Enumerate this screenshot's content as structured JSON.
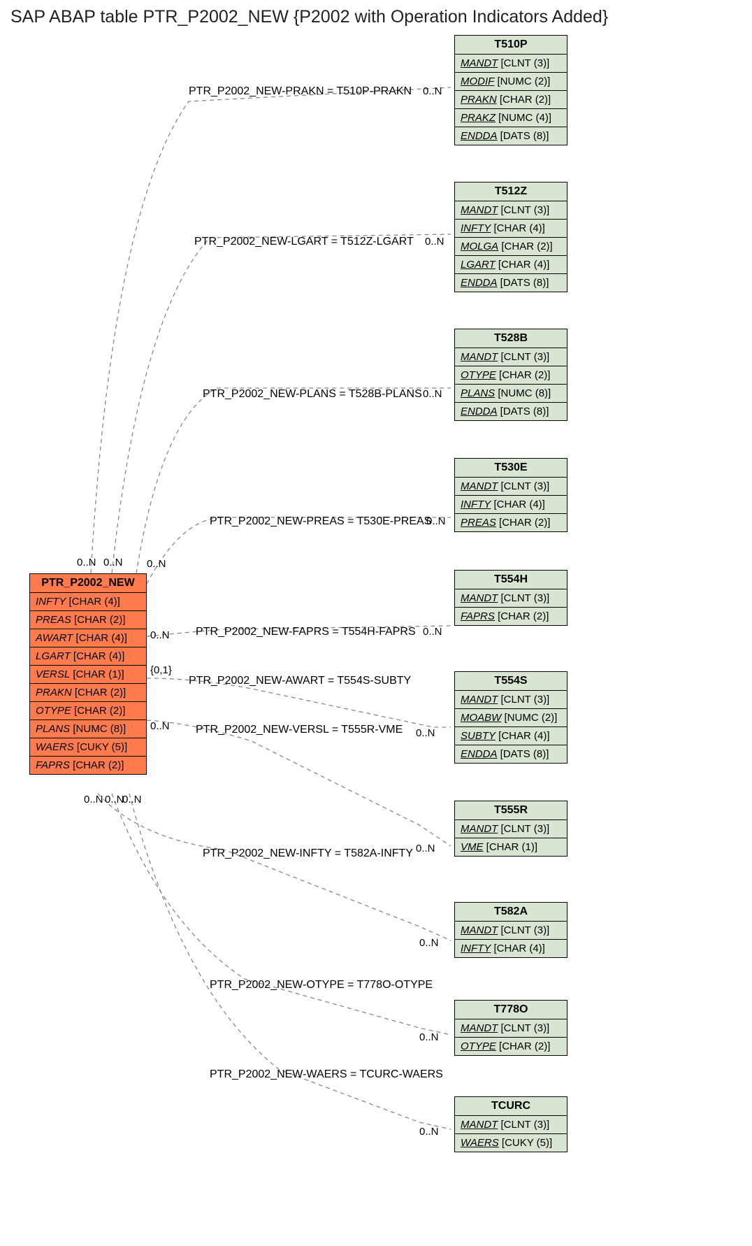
{
  "title": "SAP ABAP table PTR_P2002_NEW {P2002 with Operation Indicators Added}",
  "main": {
    "name": "PTR_P2002_NEW",
    "fields": [
      {
        "f": "INFTY",
        "t": "[CHAR (4)]"
      },
      {
        "f": "PREAS",
        "t": "[CHAR (2)]"
      },
      {
        "f": "AWART",
        "t": "[CHAR (4)]"
      },
      {
        "f": "LGART",
        "t": "[CHAR (4)]"
      },
      {
        "f": "VERSL",
        "t": "[CHAR (1)]"
      },
      {
        "f": "PRAKN",
        "t": "[CHAR (2)]"
      },
      {
        "f": "OTYPE",
        "t": "[CHAR (2)]"
      },
      {
        "f": "PLANS",
        "t": "[NUMC (8)]"
      },
      {
        "f": "WAERS",
        "t": "[CUKY (5)]"
      },
      {
        "f": "FAPRS",
        "t": "[CHAR (2)]"
      }
    ]
  },
  "targets": [
    {
      "name": "T510P",
      "fields": [
        {
          "f": "MANDT",
          "t": "[CLNT (3)]",
          "u": true
        },
        {
          "f": "MODIF",
          "t": "[NUMC (2)]",
          "u": true
        },
        {
          "f": "PRAKN",
          "t": "[CHAR (2)]",
          "u": true
        },
        {
          "f": "PRAKZ",
          "t": "[NUMC (4)]",
          "u": true
        },
        {
          "f": "ENDDA",
          "t": "[DATS (8)]",
          "u": true
        }
      ]
    },
    {
      "name": "T512Z",
      "fields": [
        {
          "f": "MANDT",
          "t": "[CLNT (3)]",
          "u": true
        },
        {
          "f": "INFTY",
          "t": "[CHAR (4)]",
          "u": true
        },
        {
          "f": "MOLGA",
          "t": "[CHAR (2)]",
          "u": true
        },
        {
          "f": "LGART",
          "t": "[CHAR (4)]",
          "u": true
        },
        {
          "f": "ENDDA",
          "t": "[DATS (8)]",
          "u": true
        }
      ]
    },
    {
      "name": "T528B",
      "fields": [
        {
          "f": "MANDT",
          "t": "[CLNT (3)]",
          "u": true
        },
        {
          "f": "OTYPE",
          "t": "[CHAR (2)]",
          "u": true
        },
        {
          "f": "PLANS",
          "t": "[NUMC (8)]",
          "u": true
        },
        {
          "f": "ENDDA",
          "t": "[DATS (8)]",
          "u": true
        }
      ]
    },
    {
      "name": "T530E",
      "fields": [
        {
          "f": "MANDT",
          "t": "[CLNT (3)]",
          "u": true
        },
        {
          "f": "INFTY",
          "t": "[CHAR (4)]",
          "u": true
        },
        {
          "f": "PREAS",
          "t": "[CHAR (2)]",
          "u": true
        }
      ]
    },
    {
      "name": "T554H",
      "fields": [
        {
          "f": "MANDT",
          "t": "[CLNT (3)]",
          "u": true
        },
        {
          "f": "FAPRS",
          "t": "[CHAR (2)]",
          "u": true
        }
      ]
    },
    {
      "name": "T554S",
      "fields": [
        {
          "f": "MANDT",
          "t": "[CLNT (3)]",
          "u": true
        },
        {
          "f": "MOABW",
          "t": "[NUMC (2)]",
          "u": true
        },
        {
          "f": "SUBTY",
          "t": "[CHAR (4)]",
          "u": true
        },
        {
          "f": "ENDDA",
          "t": "[DATS (8)]",
          "u": true
        }
      ]
    },
    {
      "name": "T555R",
      "fields": [
        {
          "f": "MANDT",
          "t": "[CLNT (3)]",
          "u": true
        },
        {
          "f": "VME",
          "t": "[CHAR (1)]",
          "u": true
        }
      ]
    },
    {
      "name": "T582A",
      "fields": [
        {
          "f": "MANDT",
          "t": "[CLNT (3)]",
          "u": true
        },
        {
          "f": "INFTY",
          "t": "[CHAR (4)]",
          "u": true
        }
      ]
    },
    {
      "name": "T778O",
      "fields": [
        {
          "f": "MANDT",
          "t": "[CLNT (3)]",
          "u": true
        },
        {
          "f": "OTYPE",
          "t": "[CHAR (2)]",
          "u": true
        }
      ]
    },
    {
      "name": "TCURC",
      "fields": [
        {
          "f": "MANDT",
          "t": "[CLNT (3)]",
          "u": true
        },
        {
          "f": "WAERS",
          "t": "[CUKY (5)]",
          "u": true
        }
      ]
    }
  ],
  "edges": [
    {
      "label": "PTR_P2002_NEW-PRAKN = T510P-PRAKN",
      "lc": "0..N",
      "rc": "0..N"
    },
    {
      "label": "PTR_P2002_NEW-LGART = T512Z-LGART",
      "lc": "0..N",
      "rc": "0..N"
    },
    {
      "label": "PTR_P2002_NEW-PLANS = T528B-PLANS",
      "lc": "0..N",
      "rc": "0..N"
    },
    {
      "label": "PTR_P2002_NEW-PREAS = T530E-PREAS",
      "lc": "0..N",
      "rc": "0..N"
    },
    {
      "label": "PTR_P2002_NEW-FAPRS = T554H-FAPRS",
      "lc": "0..N",
      "rc": "0..N"
    },
    {
      "label": "PTR_P2002_NEW-AWART = T554S-SUBTY",
      "lc": "{0,1}",
      "rc": "0..N"
    },
    {
      "label": "PTR_P2002_NEW-VERSL = T555R-VME",
      "lc": "0..N",
      "rc": "0..N"
    },
    {
      "label": "PTR_P2002_NEW-INFTY = T582A-INFTY",
      "lc": "0..N",
      "rc": "0..N"
    },
    {
      "label": "PTR_P2002_NEW-OTYPE = T778O-OTYPE",
      "lc": "0..N",
      "rc": "0..N"
    },
    {
      "label": "PTR_P2002_NEW-WAERS = TCURC-WAERS",
      "lc": "0..N",
      "rc": "0..N"
    }
  ],
  "extra_cards": [
    "0..N",
    "0..N",
    "0..N"
  ]
}
